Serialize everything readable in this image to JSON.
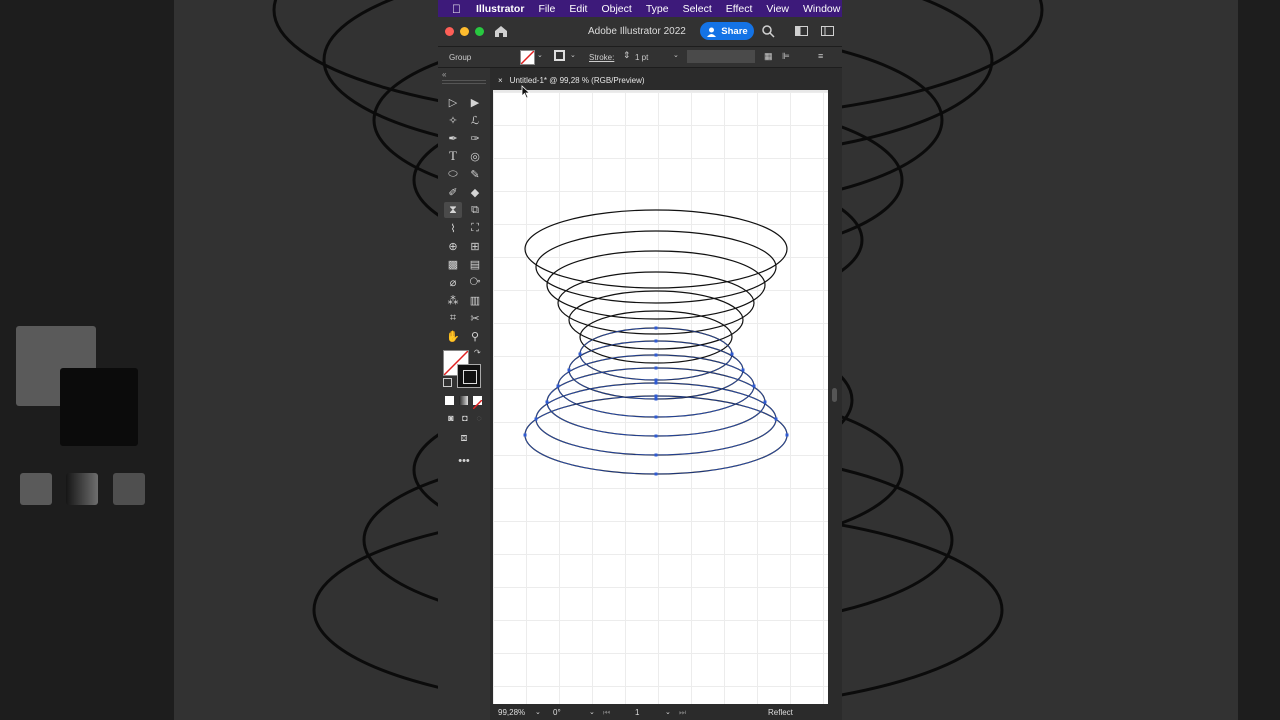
{
  "menubar": {
    "app_name": "Illustrator",
    "items": [
      "File",
      "Edit",
      "Object",
      "Type",
      "Select",
      "Effect",
      "View",
      "Window"
    ]
  },
  "titlebar": {
    "title": "Adobe Illustrator 2022",
    "share_label": "Share"
  },
  "control_bar": {
    "selection_type": "Group",
    "stroke_label": "Stroke:",
    "stroke_weight": "1 pt"
  },
  "document_tab": {
    "close_glyph": "×",
    "title": "Untitled-1* @ 99,28 % (RGB/Preview)"
  },
  "status_bar": {
    "zoom": "99,28%",
    "rotation": "0°",
    "artboard_number": "1",
    "current_tool": "Reflect"
  },
  "colors": {
    "menubar_bg": "#3d1a7a",
    "share_button": "#1473e6",
    "selection_blue": "#2f5bd3",
    "stroke_black": "#111111"
  },
  "icons": {
    "apple": "apple-icon",
    "home": "home-icon",
    "search": "search-icon",
    "arrange": "arrange-documents-icon",
    "panel": "panel-toggle-icon"
  }
}
